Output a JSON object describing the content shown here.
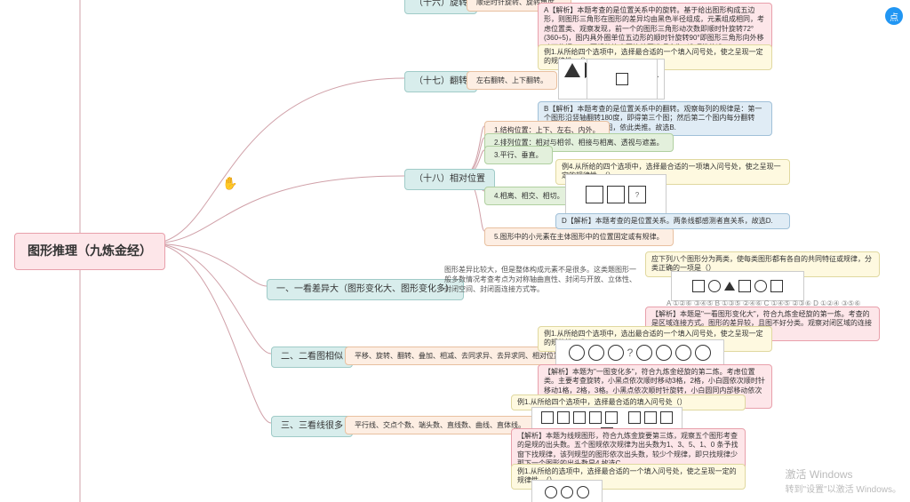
{
  "root": "图形推理（九炼金经）",
  "branches": {
    "b16": {
      "title": "（十六）旋转",
      "rule": "顺逆时针旋转、旋转角度。"
    },
    "b17": {
      "title": "（十七）翻转",
      "rule": "左右翻转、上下翻转。"
    },
    "b18": {
      "title": "（十八）相对位置",
      "items": {
        "p1": "1.结构位置：上下、左右、内外。",
        "p2": "2.排列位置：相对与相邻、相接与相离、透视与遮盖。",
        "p3": "3.平行、垂直。",
        "p4": "4.相离、相交、相切。",
        "p5": "5.图形中的小元素在主体图形中的位置固定或有规律。"
      }
    },
    "s1": {
      "title": "一、一看差异大（图形变化大、图形变化多）",
      "desc": "图形差异比较大，但是整体构成元素不是很多。这类题图形一般多数情况考查考点为对称轴曲直性、封闭与开放、立体性、封闭空间、封闭面连接方式等。"
    },
    "s2": {
      "title": "二、二看图相似",
      "rule": "平移、旋转、翻转、叠加、相减、去同求异、去异求同、相对位置。"
    },
    "s3": {
      "title": "三、三看线很多",
      "rule": "平行线、交点个数、端头数、直线数、曲线、直体线。"
    }
  },
  "examples": {
    "ex16a": "A【解析】本题考查的是位置关系中的旋转。基于给出图形构成五边形，则图形三角形在图形的差异均由黑色半径组成，元素组成相同，考虑位置类、观察发现，前一个的图形三角形动次数即顺时针旋转72°(360÷5)，图内具外圈单位五边形的顺时针旋转90°即图形三角形向外移动可依据c，D.两规律均内圈均外圈选项合为C选项性故选A.",
    "ex17q": "例1.从所给四个选项中，选择最合适的一个填入问号处，使之呈现一定的规律性。（）",
    "ex17a": "B【解析】本题考查的是位置关系中的翻转。观察每列的规律是：第一个图形沿竖轴翻转180度，即得第三个图；然后第二个图内每分翻转180度，即改第三个图，依此类推。故选B.",
    "ex18q": "例4.从所给的四个选项中，选择最合适的一项填入问号处，使之呈现一定的规律性。（）",
    "ex18a": "D【解析】本题考查的是位置关系。两条线都感测者直关系，故选D.",
    "exs1q": "应下列八个图形分为两类，使每类图形都有各自的共同特征或规律，分类正确的一项是（）",
    "exs1opts": "A ①②⑥ ③④⑤    B ①③⑤ ②④⑥    C ①④⑤ ②③⑥    D ①②④ ③⑤⑥",
    "exs1a": "【解析】本题是\"一看图形变化大\"，符合九炼金经旋的第一炼。考查的是区域连接方式。图形的差异较，且图不好分类。观察对闭区域的连接方式为，②④⑥均属内点连接，故选A.",
    "exs2q": "例1.从所给四个选项中，选出最合适的一个填入问号处，使之呈现一定的规律性。（）",
    "exs2a": "【解析】本题为\"一图变化多\"，符合九炼金经旋的第二炼。考虑位置类。主要考查旋转，小黑点依次顺时移动3格，2格，小白圆依次顺时针移动1格，2格，3格。小黑点依次顺时针旋转，小白圆同内部移动依次加一格即可。故选C.",
    "exs3q": "例1.从所给四个选项中，选择最合适的填入问号处（）",
    "exs3a": "【解析】本题为线规图形，符合九炼金旋要第三炼，观察五个图形考查的是规的出头数。五个图规依次规律为出头数为1、3、5、1、0 条予找窗下找规律，该列规型的图形依次出头数，较少个规律，即只找规律少那下一个图形的出头数是4.故选C.",
    "exs3q2": "例1.从所给的选项中，选择最合适的一个填入问号处，使之呈现一定的规律性。（）"
  },
  "watermark": {
    "l1": "激活 Windows",
    "l2": "转到\"设置\"以激活 Windows。"
  },
  "fab": "点"
}
